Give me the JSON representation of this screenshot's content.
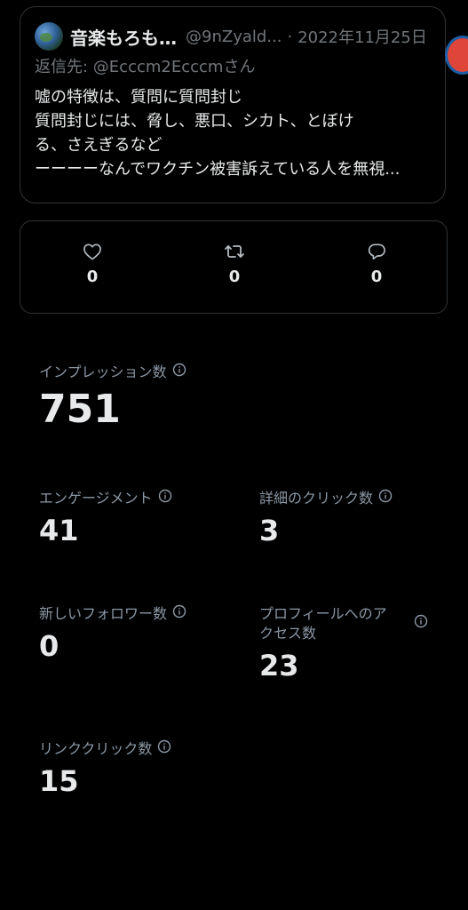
{
  "tweet": {
    "display_name": "音楽もろも…",
    "handle": "@9nZyald...",
    "separator": "·",
    "date": "2022年11月25日",
    "reply_prefix": "返信先: ",
    "reply_mention": "@Ecccm2Ecccmさん",
    "body_lines": [
      "嘘の特徴は、質問に質問封じ",
      "質問封じには、脅し、悪口、シカト、とぼけ",
      "る、さえぎるなど",
      "ーーーーなんでワクチン被害訴えている人を無視..."
    ]
  },
  "engagement": {
    "likes": {
      "icon": "heart-icon",
      "count": "0"
    },
    "retweets": {
      "icon": "retweet-icon",
      "count": "0"
    },
    "replies": {
      "icon": "reply-icon",
      "count": "0"
    }
  },
  "metrics": {
    "impressions": {
      "label": "インプレッション数",
      "value": "751"
    },
    "engagements": {
      "label": "エンゲージメント",
      "value": "41"
    },
    "detail_clicks": {
      "label": "詳細のクリック数",
      "value": "3"
    },
    "new_followers": {
      "label": "新しいフォロワー数",
      "value": "0"
    },
    "profile_visits": {
      "label_line1": "プロフィールへのア",
      "label_line2": "クセス数",
      "value": "23"
    },
    "link_clicks": {
      "label": "リンククリック数",
      "value": "15"
    }
  },
  "colors": {
    "background": "#000000",
    "primary_text": "#e7e9ea",
    "secondary_text": "#71767b",
    "label_text": "#8b98a5",
    "border": "#2f3336"
  }
}
